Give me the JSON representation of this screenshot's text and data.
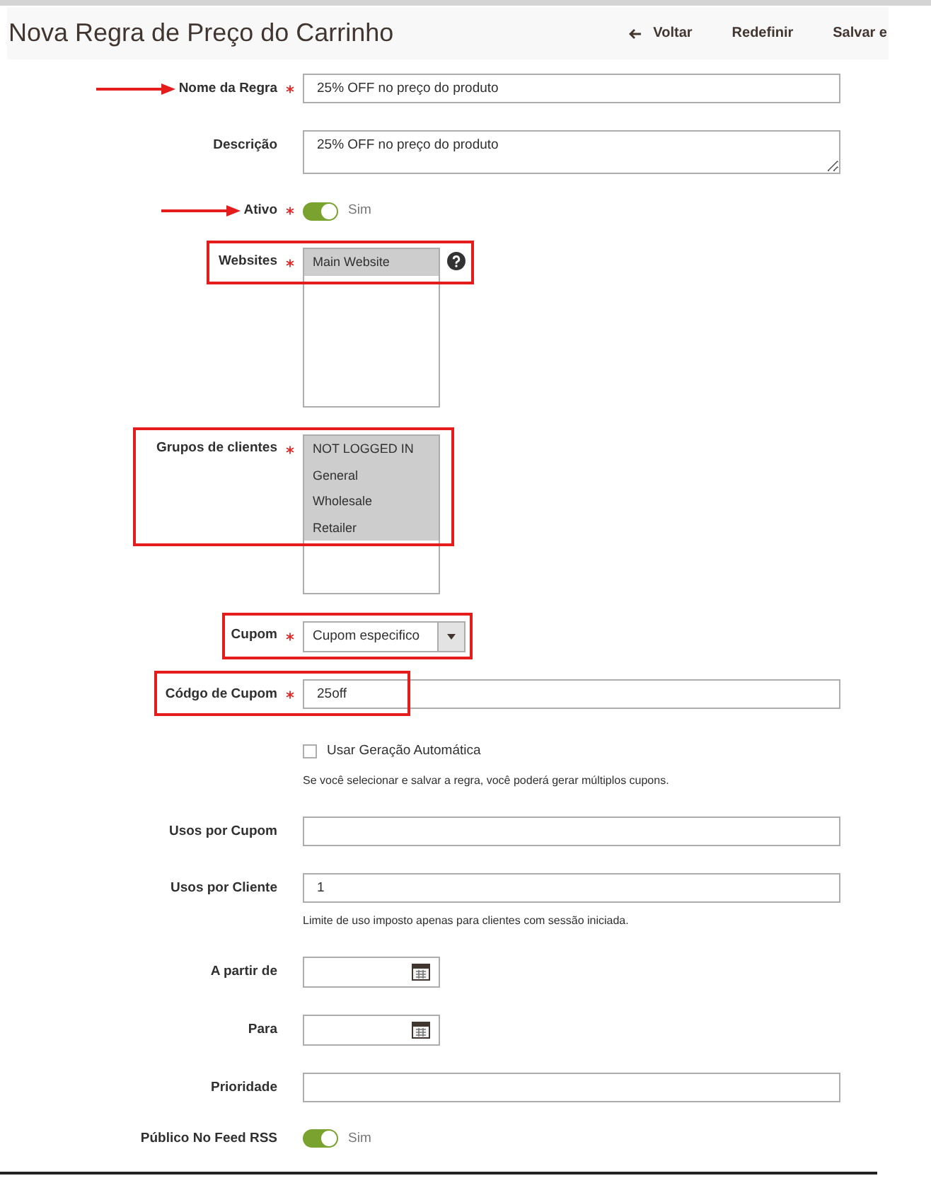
{
  "header": {
    "title": "Nova Regra de Preço do Carrinho",
    "actions": [
      {
        "label": "Voltar",
        "kind": "back"
      },
      {
        "label": "Redefinir",
        "kind": "plain"
      },
      {
        "label": "Salvar e",
        "kind": "plain"
      }
    ]
  },
  "fields": [
    {
      "kind": "text",
      "label": "Nome da Regra",
      "required": true,
      "value": "25% OFF no preço do produto",
      "pointed": true,
      "highlighted": false
    },
    {
      "kind": "textarea",
      "label": "Descrição",
      "required": false,
      "value": "25% OFF no preço do produto",
      "pointed": false,
      "highlighted": false
    },
    {
      "kind": "toggle",
      "label": "Ativo",
      "required": true,
      "on": true,
      "text": "Sim",
      "pointed": true,
      "highlighted": false
    },
    {
      "kind": "multiselect",
      "label": "Websites",
      "required": true,
      "help": true,
      "pointed": false,
      "highlighted": true,
      "options": [
        {
          "label": "Main Website",
          "selected": true
        }
      ]
    },
    {
      "kind": "multiselect",
      "label": "Grupos de clientes",
      "required": true,
      "pointed": false,
      "highlighted": true,
      "options": [
        {
          "label": "NOT LOGGED IN",
          "selected": true
        },
        {
          "label": "General",
          "selected": true
        },
        {
          "label": "Wholesale",
          "selected": true
        },
        {
          "label": "Retailer",
          "selected": true
        }
      ]
    },
    {
      "kind": "select",
      "label": "Cupom",
      "required": true,
      "value": "Cupom especifico",
      "pointed": false,
      "highlighted": true
    },
    {
      "kind": "text",
      "label": "Códgo de Cupom",
      "required": true,
      "value": "25off",
      "pointed": false,
      "highlighted": true
    },
    {
      "kind": "checkbox",
      "checked": false,
      "text": "Usar Geração Automática",
      "note": "Se você selecionar e salvar a regra, você poderá gerar múltiplos cupons."
    },
    {
      "kind": "text",
      "label": "Usos por Cupom",
      "required": false,
      "pointed": false,
      "highlighted": false
    },
    {
      "kind": "text",
      "label": "Usos por Cliente",
      "required": false,
      "value": "1",
      "note": "Limite de uso imposto apenas para clientes com sessão iniciada.",
      "pointed": false,
      "highlighted": false
    },
    {
      "kind": "date",
      "label": "A partir de",
      "required": false,
      "pointed": false,
      "highlighted": false
    },
    {
      "kind": "date",
      "label": "Para",
      "required": false,
      "pointed": false,
      "highlighted": false
    },
    {
      "kind": "text",
      "label": "Prioridade",
      "required": false,
      "pointed": false,
      "highlighted": false
    },
    {
      "kind": "toggle",
      "label": "Público No Feed RSS",
      "required": false,
      "on": true,
      "text": "Sim",
      "pointed": false,
      "highlighted": false
    }
  ]
}
